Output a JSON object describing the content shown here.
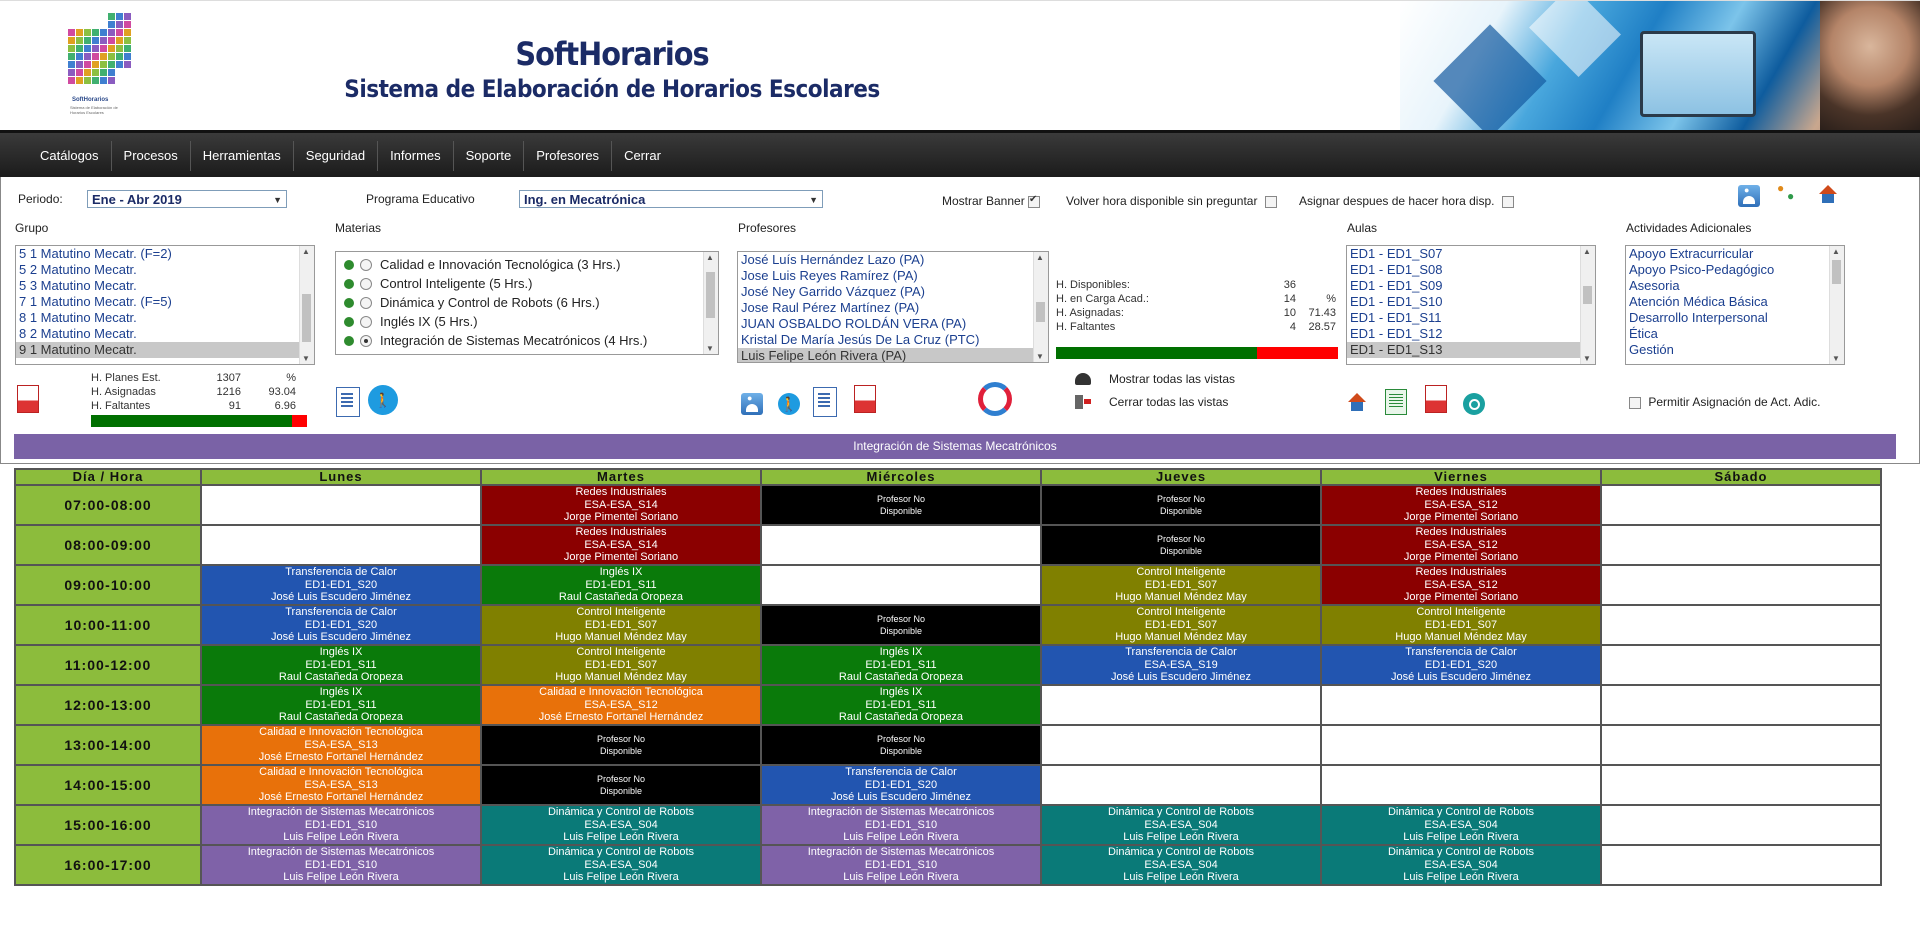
{
  "header": {
    "app_title": "SoftHorarios",
    "app_subtitle": "Sistema de Elaboración de Horarios Escolares",
    "logo_caption": "SoftHorarios",
    "logo_tagline": "Sistema de Elaboración de Horarios Escolares"
  },
  "menu": [
    "Catálogos",
    "Procesos",
    "Herramientas",
    "Seguridad",
    "Informes",
    "Soporte",
    "Profesores",
    "Cerrar"
  ],
  "filters": {
    "periodo_label": "Periodo:",
    "periodo_value": "Ene - Abr 2019",
    "programa_label": "Programa Educativo",
    "programa_value": "Ing. en Mecatrónica",
    "mostrar_banner_label": "Mostrar Banner",
    "volver_label": "Volver hora disponible sin preguntar",
    "asignar_label": "Asignar despues de hacer hora disp."
  },
  "grupo": {
    "label": "Grupo",
    "items": [
      "5 1 Matutino Mecatr. (F=2)",
      "5 2 Matutino Mecatr.",
      "5 3 Matutino Mecatr.",
      "7 1 Matutino Mecatr. (F=5)",
      "8 1 Matutino Mecatr.",
      "8 2 Matutino Mecatr.",
      "9 1 Matutino Mecatr."
    ],
    "selected_index": 6,
    "stats": [
      {
        "label": "H. Planes Est.",
        "value": "1307",
        "pct": "%"
      },
      {
        "label": "H. Asignadas",
        "value": "1216",
        "pct": "93.04"
      },
      {
        "label": "H. Faltantes",
        "value": "91",
        "pct": "6.96"
      }
    ],
    "progress_pct": 93.04
  },
  "materias": {
    "label": "Materias",
    "items": [
      {
        "text": "Calidad e Innovación Tecnológica (3 Hrs.)",
        "checked": false
      },
      {
        "text": "Control Inteligente (5 Hrs.)",
        "checked": false
      },
      {
        "text": "Dinámica y Control de Robots (6 Hrs.)",
        "checked": false
      },
      {
        "text": "Inglés IX (5 Hrs.)",
        "checked": false
      },
      {
        "text": "Integración de Sistemas Mecatrónicos (4 Hrs.)",
        "checked": true
      }
    ]
  },
  "profesores": {
    "label": "Profesores",
    "items": [
      "José Luís Hernández Lazo (PA)",
      "Jose Luis Reyes Ramírez (PA)",
      "José Ney Garrido Vázquez (PA)",
      "Jose Raul Pérez Martínez (PA)",
      "JUAN OSBALDO ROLDÁN VERA (PA)",
      "Kristal De María Jesús De La Cruz (PTC)",
      "Luis Felipe León Rivera (PA)"
    ],
    "selected_index": 6,
    "stats": [
      {
        "label": "H. Disponibles:",
        "value": "36",
        "pct": ""
      },
      {
        "label": "H. en Carga Acad.:",
        "value": "14",
        "pct": "%"
      },
      {
        "label": "H. Asignadas:",
        "value": "10",
        "pct": "71.43"
      },
      {
        "label": "H. Faltantes",
        "value": "4",
        "pct": "28.57"
      }
    ],
    "progress_pct": 71.43,
    "mostrar_vistas": "Mostrar todas las vistas",
    "cerrar_vistas": "Cerrar todas las vistas"
  },
  "aulas": {
    "label": "Aulas",
    "items": [
      "ED1 - ED1_S07",
      "ED1 - ED1_S08",
      "ED1 - ED1_S09",
      "ED1 - ED1_S10",
      "ED1 - ED1_S11",
      "ED1 - ED1_S12",
      "ED1 - ED1_S13"
    ],
    "selected_index": 6
  },
  "actividades": {
    "label": "Actividades Adicionales",
    "items": [
      "Apoyo Extracurricular",
      "Apoyo Psico-Pedagógico",
      "Asesoria",
      "Atención Médica Básica",
      "Desarrollo Interpersonal",
      "Ética",
      "Gestión"
    ],
    "permitir_label": "Permitir Asignación de Act. Adic."
  },
  "selected_subject_bar": "Integración de Sistemas Mecatrónicos",
  "timetable": {
    "headers": [
      "Día / Hora",
      "Lunes",
      "Martes",
      "Miércoles",
      "Jueves",
      "Viernes",
      "Sábado"
    ],
    "colors": {
      "red": "#8b0000",
      "blue": "#2255b0",
      "green": "#0a7a0a",
      "olive": "#808000",
      "orange": "#e8710a",
      "purple": "#7f62a8",
      "teal": "#0a7a78",
      "black": "#000000"
    },
    "rows": [
      {
        "hour": "07:00-08:00",
        "cells": [
          {
            "type": "empty"
          },
          {
            "type": "class",
            "color": "red",
            "lines": [
              "Redes Industriales",
              "ESA-ESA_S14",
              "Jorge Pimentel Soriano"
            ]
          },
          {
            "type": "na",
            "lines": [
              "Profesor No",
              "Disponible"
            ]
          },
          {
            "type": "na",
            "lines": [
              "Profesor No",
              "Disponible"
            ]
          },
          {
            "type": "class",
            "color": "red",
            "lines": [
              "Redes Industriales",
              "ESA-ESA_S12",
              "Jorge Pimentel Soriano"
            ]
          },
          {
            "type": "empty"
          }
        ]
      },
      {
        "hour": "08:00-09:00",
        "cells": [
          {
            "type": "empty"
          },
          {
            "type": "class",
            "color": "red",
            "lines": [
              "Redes Industriales",
              "ESA-ESA_S14",
              "Jorge Pimentel Soriano"
            ]
          },
          {
            "type": "empty"
          },
          {
            "type": "na",
            "lines": [
              "Profesor No",
              "Disponible"
            ]
          },
          {
            "type": "class",
            "color": "red",
            "lines": [
              "Redes Industriales",
              "ESA-ESA_S12",
              "Jorge Pimentel Soriano"
            ]
          },
          {
            "type": "empty"
          }
        ]
      },
      {
        "hour": "09:00-10:00",
        "cells": [
          {
            "type": "class",
            "color": "blue",
            "lines": [
              "Transferencia de Calor",
              "ED1-ED1_S20",
              "José Luis Escudero Jiménez"
            ]
          },
          {
            "type": "class",
            "color": "green",
            "lines": [
              "Inglés IX",
              "ED1-ED1_S11",
              "Raul Castañeda Oropeza"
            ]
          },
          {
            "type": "empty"
          },
          {
            "type": "class",
            "color": "olive",
            "lines": [
              "Control Inteligente",
              "ED1-ED1_S07",
              "Hugo Manuel Méndez May"
            ]
          },
          {
            "type": "class",
            "color": "red",
            "lines": [
              "Redes Industriales",
              "ESA-ESA_S12",
              "Jorge Pimentel Soriano"
            ]
          },
          {
            "type": "empty"
          }
        ]
      },
      {
        "hour": "10:00-11:00",
        "cells": [
          {
            "type": "class",
            "color": "blue",
            "lines": [
              "Transferencia de Calor",
              "ED1-ED1_S20",
              "José Luis Escudero Jiménez"
            ]
          },
          {
            "type": "class",
            "color": "olive",
            "lines": [
              "Control Inteligente",
              "ED1-ED1_S07",
              "Hugo Manuel Méndez May"
            ]
          },
          {
            "type": "na",
            "lines": [
              "Profesor No",
              "Disponible"
            ]
          },
          {
            "type": "class",
            "color": "olive",
            "lines": [
              "Control Inteligente",
              "ED1-ED1_S07",
              "Hugo Manuel Méndez May"
            ]
          },
          {
            "type": "class",
            "color": "olive",
            "lines": [
              "Control Inteligente",
              "ED1-ED1_S07",
              "Hugo Manuel Méndez May"
            ]
          },
          {
            "type": "empty"
          }
        ]
      },
      {
        "hour": "11:00-12:00",
        "cells": [
          {
            "type": "class",
            "color": "green",
            "lines": [
              "Inglés IX",
              "ED1-ED1_S11",
              "Raul Castañeda Oropeza"
            ]
          },
          {
            "type": "class",
            "color": "olive",
            "lines": [
              "Control Inteligente",
              "ED1-ED1_S07",
              "Hugo Manuel Méndez May"
            ]
          },
          {
            "type": "class",
            "color": "green",
            "lines": [
              "Inglés IX",
              "ED1-ED1_S11",
              "Raul Castañeda Oropeza"
            ]
          },
          {
            "type": "class",
            "color": "blue",
            "lines": [
              "Transferencia de Calor",
              "ESA-ESA_S19",
              "José Luis Escudero Jiménez"
            ]
          },
          {
            "type": "class",
            "color": "blue",
            "lines": [
              "Transferencia de Calor",
              "ED1-ED1_S20",
              "José Luis Escudero Jiménez"
            ]
          },
          {
            "type": "empty"
          }
        ]
      },
      {
        "hour": "12:00-13:00",
        "cells": [
          {
            "type": "class",
            "color": "green",
            "lines": [
              "Inglés IX",
              "ED1-ED1_S11",
              "Raul Castañeda Oropeza"
            ]
          },
          {
            "type": "class",
            "color": "orange",
            "lines": [
              "Calidad e Innovación Tecnológica",
              "ESA-ESA_S12",
              "José Ernesto Fortanel Hernández"
            ]
          },
          {
            "type": "class",
            "color": "green",
            "lines": [
              "Inglés IX",
              "ED1-ED1_S11",
              "Raul Castañeda Oropeza"
            ]
          },
          {
            "type": "empty"
          },
          {
            "type": "empty"
          },
          {
            "type": "empty"
          }
        ]
      },
      {
        "hour": "13:00-14:00",
        "cells": [
          {
            "type": "class",
            "color": "orange",
            "lines": [
              "Calidad e Innovación Tecnológica",
              "ESA-ESA_S13",
              "José Ernesto Fortanel Hernández"
            ]
          },
          {
            "type": "na",
            "lines": [
              "Profesor No",
              "Disponible"
            ]
          },
          {
            "type": "na",
            "lines": [
              "Profesor No",
              "Disponible"
            ]
          },
          {
            "type": "empty"
          },
          {
            "type": "empty"
          },
          {
            "type": "empty"
          }
        ]
      },
      {
        "hour": "14:00-15:00",
        "cells": [
          {
            "type": "class",
            "color": "orange",
            "lines": [
              "Calidad e Innovación Tecnológica",
              "ESA-ESA_S13",
              "José Ernesto Fortanel Hernández"
            ]
          },
          {
            "type": "na",
            "lines": [
              "Profesor No",
              "Disponible"
            ]
          },
          {
            "type": "class",
            "color": "blue",
            "lines": [
              "Transferencia de Calor",
              "ED1-ED1_S20",
              "José Luis Escudero Jiménez"
            ]
          },
          {
            "type": "empty"
          },
          {
            "type": "empty"
          },
          {
            "type": "empty"
          }
        ]
      },
      {
        "hour": "15:00-16:00",
        "cells": [
          {
            "type": "class",
            "color": "purple",
            "lines": [
              "Integración de Sistemas Mecatrónicos",
              "ED1-ED1_S10",
              "Luis Felipe León Rivera"
            ]
          },
          {
            "type": "class",
            "color": "teal",
            "lines": [
              "Dinámica y Control de Robots",
              "ESA-ESA_S04",
              "Luis Felipe León Rivera"
            ]
          },
          {
            "type": "class",
            "color": "purple",
            "lines": [
              "Integración de Sistemas Mecatrónicos",
              "ED1-ED1_S10",
              "Luis Felipe León Rivera"
            ]
          },
          {
            "type": "class",
            "color": "teal",
            "lines": [
              "Dinámica y Control de Robots",
              "ESA-ESA_S04",
              "Luis Felipe León Rivera"
            ]
          },
          {
            "type": "class",
            "color": "teal",
            "lines": [
              "Dinámica y Control de Robots",
              "ESA-ESA_S04",
              "Luis Felipe León Rivera"
            ]
          },
          {
            "type": "empty"
          }
        ]
      },
      {
        "hour": "16:00-17:00",
        "cells": [
          {
            "type": "class",
            "color": "purple",
            "lines": [
              "Integración de Sistemas Mecatrónicos",
              "ED1-ED1_S10",
              "Luis Felipe León Rivera"
            ]
          },
          {
            "type": "class",
            "color": "teal",
            "lines": [
              "Dinámica y Control de Robots",
              "ESA-ESA_S04",
              "Luis Felipe León Rivera"
            ]
          },
          {
            "type": "class",
            "color": "purple",
            "lines": [
              "Integración de Sistemas Mecatrónicos",
              "ED1-ED1_S10",
              "Luis Felipe León Rivera"
            ]
          },
          {
            "type": "class",
            "color": "teal",
            "lines": [
              "Dinámica y Control de Robots",
              "ESA-ESA_S04",
              "Luis Felipe León Rivera"
            ]
          },
          {
            "type": "class",
            "color": "teal",
            "lines": [
              "Dinámica y Control de Robots",
              "ESA-ESA_S04",
              "Luis Felipe León Rivera"
            ]
          },
          {
            "type": "empty"
          }
        ]
      }
    ]
  }
}
